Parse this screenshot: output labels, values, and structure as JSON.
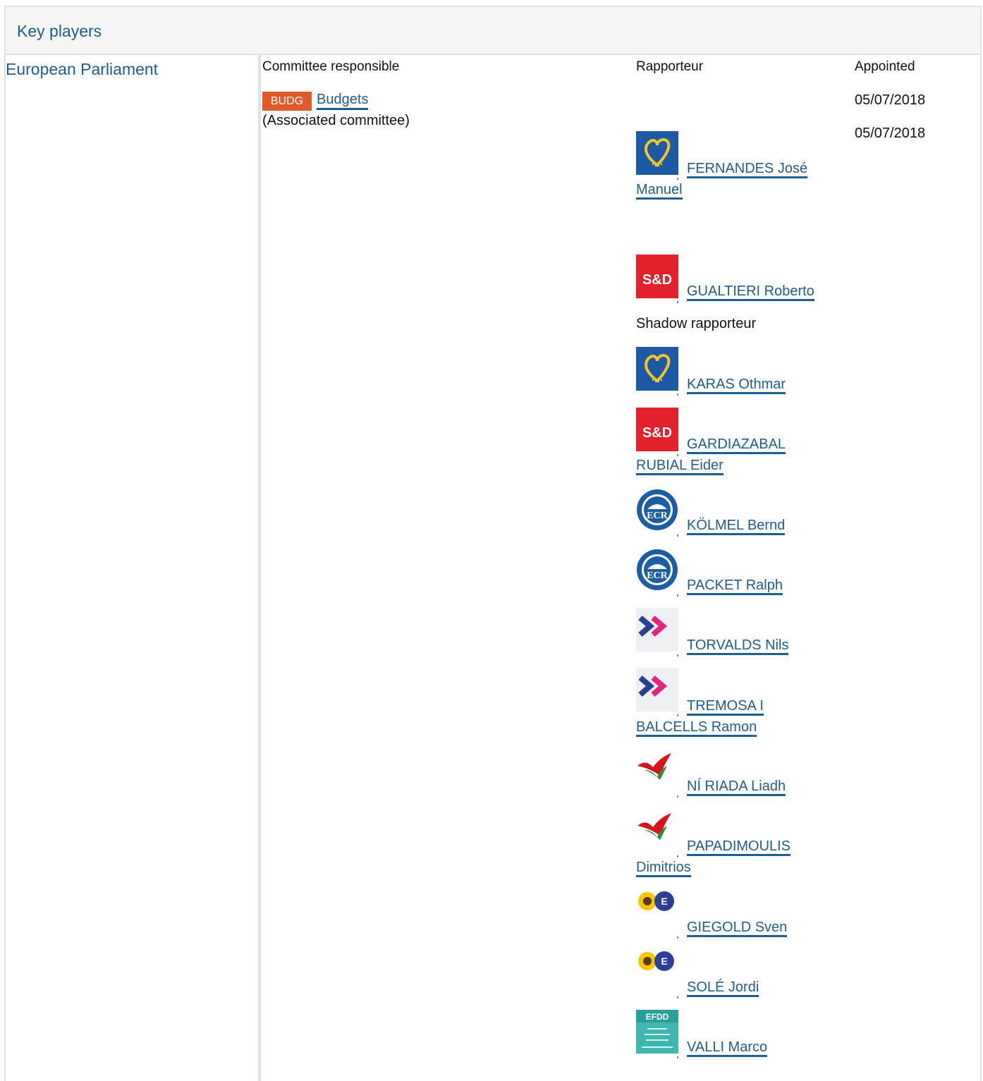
{
  "section": {
    "title": "Key players"
  },
  "institution": {
    "label": "European Parliament"
  },
  "columns": {
    "committee": "Committee responsible",
    "rapporteur": "Rapporteur",
    "appointed": "Appointed"
  },
  "committee": {
    "code": "BUDG",
    "name": "Budgets",
    "note": "(Associated committee)",
    "badge_color": "#e05a2a"
  },
  "appointed_dates": [
    "05/07/2018",
    "05/07/2018"
  ],
  "rapporteurs": [
    {
      "name": "FERNANDES José Manuel",
      "group_icon": "epp-icon"
    },
    {
      "name": "GUALTIERI Roberto",
      "group_icon": "sd-icon"
    }
  ],
  "shadow_label": "Shadow rapporteur",
  "shadow_rapporteurs": [
    {
      "name": "KARAS Othmar",
      "group_icon": "epp-icon"
    },
    {
      "name": "GARDIAZABAL RUBIAL Eider",
      "group_icon": "sd-icon"
    },
    {
      "name": "KÖLMEL Bernd",
      "group_icon": "ecr-icon"
    },
    {
      "name": "PACKET Ralph",
      "group_icon": "ecr-icon"
    },
    {
      "name": "TORVALDS Nils",
      "group_icon": "alde-icon"
    },
    {
      "name": "TREMOSA I BALCELLS Ramon",
      "group_icon": "alde-icon"
    },
    {
      "name": "NÍ RIADA Liadh",
      "group_icon": "gue-ngl-icon"
    },
    {
      "name": "PAPADIMOULIS Dimitrios",
      "group_icon": "gue-ngl-icon"
    },
    {
      "name": "GIEGOLD Sven",
      "group_icon": "greens-efa-icon"
    },
    {
      "name": "SOLÉ Jordi",
      "group_icon": "greens-efa-icon"
    },
    {
      "name": "VALLI Marco",
      "group_icon": "efdd-icon"
    }
  ],
  "icon_labels": {
    "sd": "S&D",
    "ecr": "ECR",
    "efdd": "EFDD"
  },
  "colors": {
    "link": "#1f5c8f",
    "epp": "#1c5aa6",
    "sd": "#e3212b",
    "ecr": "#1b5ea6"
  }
}
